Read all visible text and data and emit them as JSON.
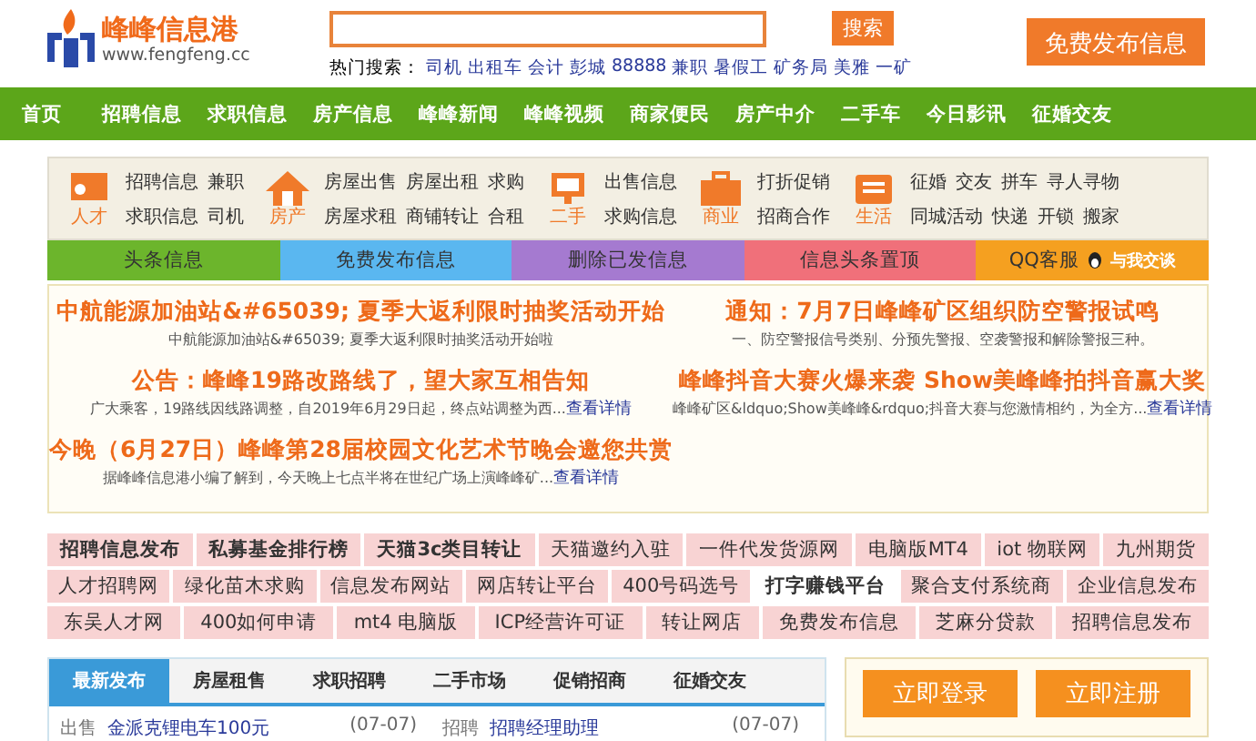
{
  "header": {
    "logo_name": "峰峰信息港",
    "logo_url": "www.fengfeng.cc",
    "search_button": "搜索",
    "hot_label": "热门搜索：",
    "hot_terms": [
      "司机",
      "出租车",
      "会计",
      "彭城",
      "88888",
      "兼职",
      "暑假工",
      "矿务局",
      "美雅",
      "一矿"
    ],
    "publish_button": "免费发布信息"
  },
  "nav": {
    "items": [
      "首页",
      "招聘信息",
      "求职信息",
      "房产信息",
      "峰峰新闻",
      "峰峰视频",
      "商家便民",
      "房产中介",
      "二手车",
      "今日影讯",
      "征婚交友"
    ]
  },
  "categories": [
    {
      "kind": "talent",
      "label": "人才",
      "links": [
        "招聘信息",
        "兼职",
        "求职信息",
        "司机"
      ]
    },
    {
      "kind": "house",
      "label": "房产",
      "links": [
        "房屋出售",
        "房屋出租",
        "求购",
        "房屋求租",
        "商铺转让",
        "合租"
      ]
    },
    {
      "kind": "secondhand",
      "label": "二手",
      "links": [
        "出售信息",
        "求购信息"
      ]
    },
    {
      "kind": "business",
      "label": "商业",
      "links": [
        "打折促销",
        "招商合作"
      ]
    },
    {
      "kind": "life",
      "label": "生活",
      "links": [
        "征婚",
        "交友",
        "拼车",
        "寻人寻物",
        "同城活动",
        "快递",
        "开锁",
        "搬家"
      ]
    }
  ],
  "bars": [
    {
      "kind": "plain",
      "label": "头条信息",
      "color": "#6cb52c"
    },
    {
      "kind": "plain",
      "label": "免费发布信息",
      "color": "#5ab7f0"
    },
    {
      "kind": "plain",
      "label": "删除已发信息",
      "color": "#a57ad0"
    },
    {
      "kind": "plain",
      "label": "信息头条置顶",
      "color": "#f0707a"
    },
    {
      "kind": "qq",
      "label": "QQ客服",
      "chat": "与我交谈",
      "color": "#f5a020"
    }
  ],
  "news": [
    {
      "title": "中航能源加油站&#65039; 夏季大返利限时抽奖活动开始",
      "summary": "中航能源加油站&#65039; 夏季大返利限时抽奖活动开始啦"
    },
    {
      "title": "通知：7月7日峰峰矿区组织防空警报试鸣",
      "summary": "一、防空警报信号类别、分预先警报、空袭警报和解除警报三种。"
    },
    {
      "title": "公告：峰峰19路改路线了，望大家互相告知",
      "summary": "广大乘客，19路线因线路调整，自2019年6月29日起，终点站调整为西...",
      "more": "查看详情"
    },
    {
      "title": "峰峰抖音大赛火爆来袭 Show美峰峰拍抖音赢大奖",
      "summary": "峰峰矿区&ldquo;Show美峰峰&rdquo;抖音大赛与您激情相约，为全方...",
      "more": "查看详情"
    },
    {
      "title": "今晚（6月27日）峰峰第28届校园文化艺术节晚会邀您共赏",
      "summary": "据峰峰信息港小编了解到，今天晚上七点半将在世纪广场上演峰峰矿...",
      "more": "查看详情"
    }
  ],
  "links": [
    [
      {
        "label": "招聘信息发布",
        "bold": true,
        "selected": false
      },
      {
        "label": "私募基金排行榜",
        "bold": true,
        "selected": false
      },
      {
        "label": "天猫3c类目转让",
        "bold": true,
        "selected": false
      },
      {
        "label": "天猫邀约入驻",
        "bold": false,
        "selected": false
      },
      {
        "label": "一件代发货源网",
        "bold": false,
        "selected": false
      },
      {
        "label": "电脑版MT4",
        "bold": false,
        "selected": false
      },
      {
        "label": "iot 物联网",
        "bold": false,
        "selected": false
      },
      {
        "label": "九州期货",
        "bold": false,
        "selected": false
      }
    ],
    [
      {
        "label": "人才招聘网",
        "bold": false,
        "selected": false
      },
      {
        "label": "绿化苗木求购",
        "bold": false,
        "selected": false
      },
      {
        "label": "信息发布网站",
        "bold": false,
        "selected": false
      },
      {
        "label": "网店转让平台",
        "bold": false,
        "selected": false
      },
      {
        "label": "400号码选号",
        "bold": false,
        "selected": false
      },
      {
        "label": "打字赚钱平台",
        "bold": true,
        "selected": true
      },
      {
        "label": "聚合支付系统商",
        "bold": false,
        "selected": false
      },
      {
        "label": "企业信息发布",
        "bold": false,
        "selected": false
      }
    ],
    [
      {
        "label": "东吴人才网",
        "bold": false,
        "selected": false
      },
      {
        "label": "400如何申请",
        "bold": false,
        "selected": false
      },
      {
        "label": "mt4 电脑版",
        "bold": false,
        "selected": false
      },
      {
        "label": "ICP经营许可证",
        "bold": false,
        "selected": false
      },
      {
        "label": "转让网店",
        "bold": false,
        "selected": false
      },
      {
        "label": "免费发布信息",
        "bold": false,
        "selected": false
      },
      {
        "label": "芝麻分贷款",
        "bold": false,
        "selected": false
      },
      {
        "label": "招聘信息发布",
        "bold": false,
        "selected": false
      }
    ]
  ],
  "listing": {
    "tabs": [
      {
        "label": "最新发布",
        "selected": true
      },
      {
        "label": "房屋租售",
        "selected": false
      },
      {
        "label": "求职招聘",
        "selected": false
      },
      {
        "label": "二手市场",
        "selected": false
      },
      {
        "label": "促销招商",
        "selected": false
      },
      {
        "label": "征婚交友",
        "selected": false
      }
    ],
    "rows": [
      {
        "type": "出售",
        "title": "金派克锂电车100元",
        "date": "(07-07)"
      },
      {
        "type": "招聘",
        "title": "招聘经理助理",
        "date": "(07-07)"
      }
    ]
  },
  "account": {
    "buttons": [
      "立即登录",
      "立即注册"
    ]
  }
}
